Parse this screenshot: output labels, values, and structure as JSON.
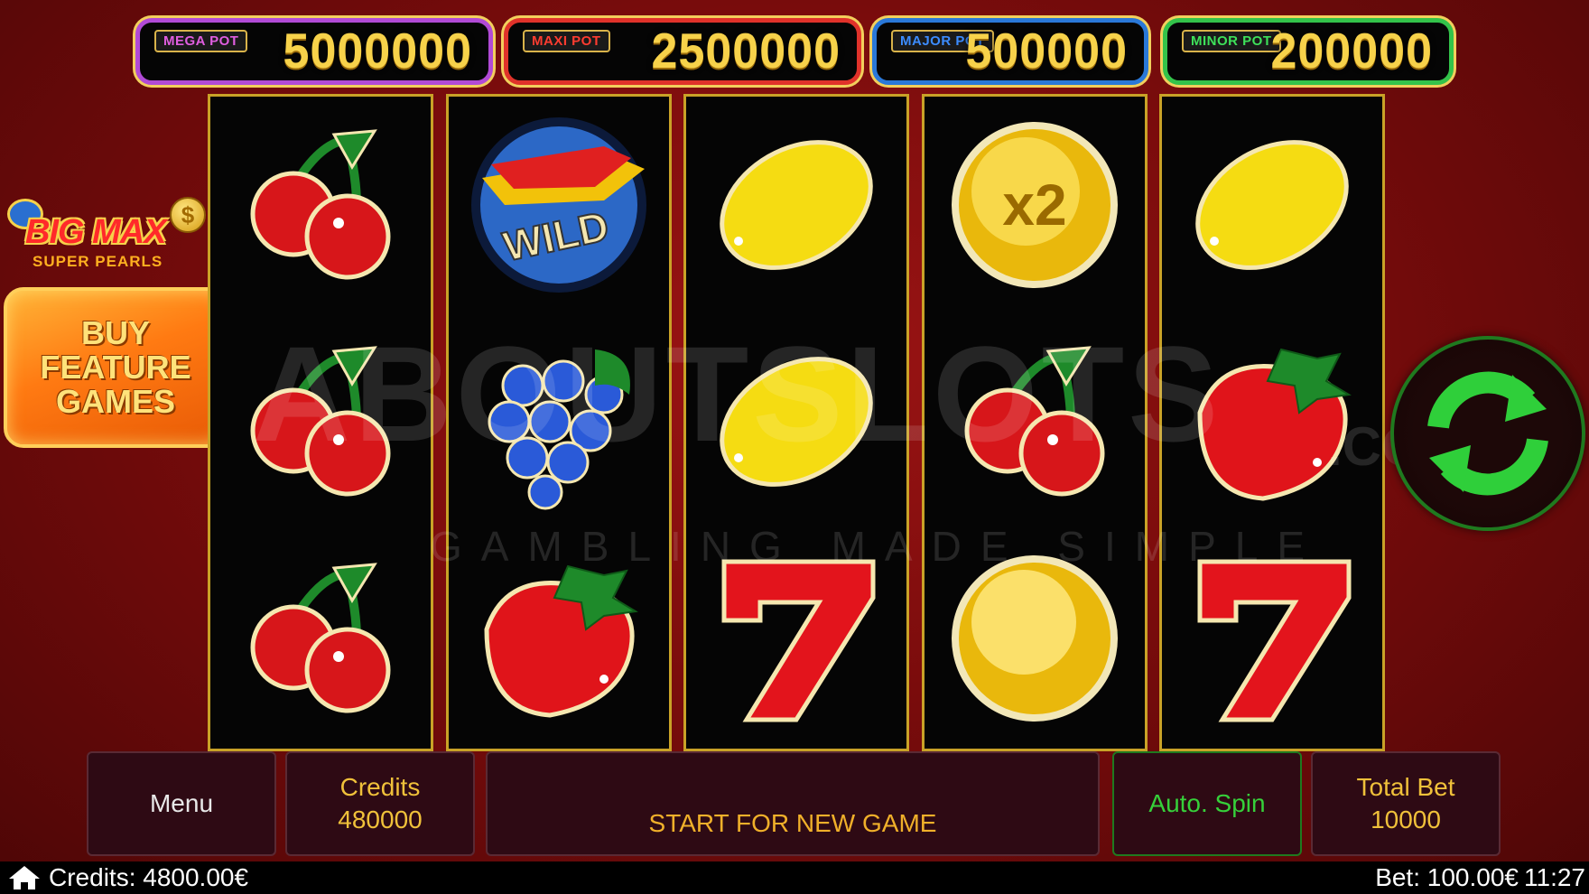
{
  "jackpots": [
    {
      "label": "MEGA POT",
      "amount": "5000000",
      "color": "#b14ad6"
    },
    {
      "label": "MAXI POT",
      "amount": "2500000",
      "color": "#e0322a"
    },
    {
      "label": "MAJOR POT",
      "amount": "500000",
      "color": "#2a78d8"
    },
    {
      "label": "MINOR POT",
      "amount": "200000",
      "color": "#33c34a"
    }
  ],
  "logo": {
    "name": "BIG MAX",
    "subtitle": "SUPER PEARLS",
    "coin_symbol": "$"
  },
  "buy_feature": {
    "line1": "BUY",
    "line2": "FEATURE",
    "line3": "GAMES"
  },
  "reels": [
    [
      "cherry",
      "cherry",
      "cherry"
    ],
    [
      "wild",
      "grapes",
      "strawberry"
    ],
    [
      "lemon",
      "lemon",
      "seven"
    ],
    [
      "pearl-x2",
      "cherry",
      "pearl"
    ],
    [
      "lemon",
      "strawberry",
      "seven"
    ]
  ],
  "symbol_text": {
    "wild": "WILD",
    "multiplier": "x2"
  },
  "spin_button": {
    "icon": "refresh-arrows-icon",
    "color": "#2fcf3a"
  },
  "watermark": {
    "brand": "ABOUTSLOTS",
    "suffix": ".COM",
    "tagline": "GAMBLING MADE SIMPLE"
  },
  "panel": {
    "menu_label": "Menu",
    "credits_label": "Credits",
    "credits_value": "480000",
    "status_text": "START FOR NEW GAME",
    "auto_spin_label": "Auto. Spin",
    "total_bet_label": "Total Bet",
    "total_bet_value": "10000"
  },
  "statusbar": {
    "home_icon": "home-icon",
    "credits": "Credits: 4800.00€",
    "bet": "Bet: 100.00€",
    "time": "11:27"
  }
}
